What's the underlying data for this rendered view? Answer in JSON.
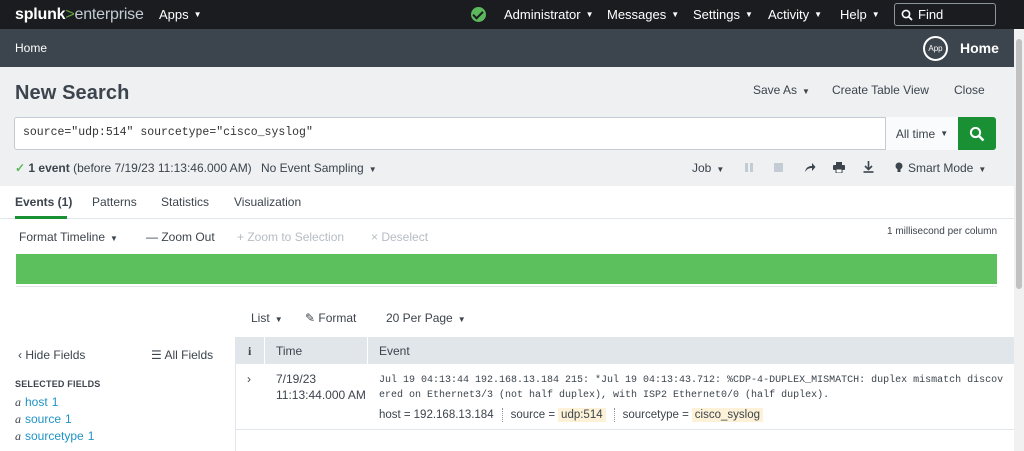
{
  "topbar": {
    "logo_main": "splunk",
    "logo_gt": ">",
    "logo_sub": "enterprise",
    "apps": "Apps",
    "administrator": "Administrator",
    "messages": "Messages",
    "settings": "Settings",
    "activity": "Activity",
    "help": "Help",
    "find": "Find",
    "health_status_color": "#5cb85c"
  },
  "appbar": {
    "home": "Home",
    "app_badge": "App",
    "app_title": "Home"
  },
  "search": {
    "title": "New Search",
    "save_as": "Save As",
    "create_table_view": "Create Table View",
    "close": "Close",
    "query": "source=\"udp:514\" sourcetype=\"cisco_syslog\"",
    "time_range": "All time",
    "accent_color": "#1a9035"
  },
  "status": {
    "count": "1 event",
    "detail": "(before 7/19/23 11:13:46.000 AM)",
    "sampling": "No Event Sampling",
    "job": "Job",
    "mode": "Smart Mode"
  },
  "tabs": [
    {
      "label": "Events (1)"
    },
    {
      "label": "Patterns"
    },
    {
      "label": "Statistics"
    },
    {
      "label": "Visualization"
    }
  ],
  "timeline": {
    "format": "Format Timeline",
    "zoom_out": "Zoom Out",
    "zoom_selection": "Zoom to Selection",
    "deselect": "Deselect",
    "scale": "1 millisecond per column",
    "bar_color": "#5cc05c"
  },
  "list_controls": {
    "list": "List",
    "format": "Format",
    "per_page": "20 Per Page"
  },
  "fields": {
    "hide": "Hide Fields",
    "all": "All Fields",
    "selected_title": "SELECTED FIELDS",
    "selected": [
      {
        "type": "a",
        "name": "host",
        "count": "1"
      },
      {
        "type": "a",
        "name": "source",
        "count": "1"
      },
      {
        "type": "a",
        "name": "sourcetype",
        "count": "1"
      }
    ]
  },
  "events": {
    "headers": {
      "info": "i",
      "time": "Time",
      "event": "Event"
    },
    "rows": [
      {
        "date": "7/19/23",
        "time": "11:13:44.000 AM",
        "raw": "Jul 19 04:13:44 192.168.13.184 215: *Jul 19 04:13:43.712: %CDP-4-DUPLEX_MISMATCH: duplex mismatch discovered on Ethernet3/3 (not half duplex), with ISP2 Ethernet0/0 (half duplex).",
        "host_label": "host =",
        "host": "192.168.13.184",
        "source_label": "source =",
        "source": "udp:514",
        "sourcetype_label": "sourcetype =",
        "sourcetype": "cisco_syslog"
      }
    ]
  }
}
